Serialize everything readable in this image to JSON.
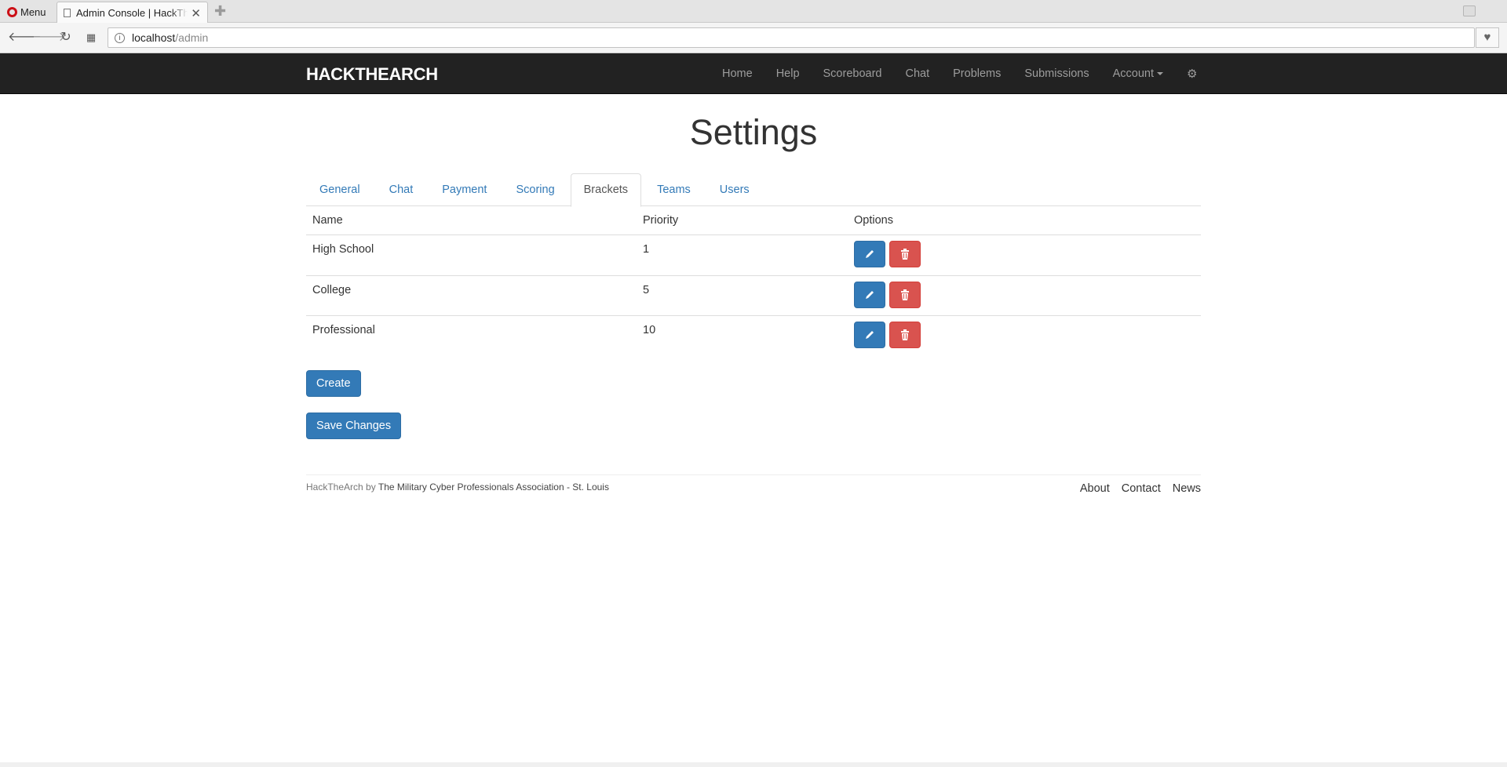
{
  "browser": {
    "menu_label": "Menu",
    "tab_title": "Admin Console | HackTheArch",
    "url_host": "localhost",
    "url_path": "/admin"
  },
  "navbar": {
    "brand": "HACKTHEARCH",
    "links": [
      "Home",
      "Help",
      "Scoreboard",
      "Chat",
      "Problems",
      "Submissions"
    ],
    "account": "Account"
  },
  "page": {
    "title": "Settings",
    "tabs": [
      "General",
      "Chat",
      "Payment",
      "Scoring",
      "Brackets",
      "Teams",
      "Users"
    ],
    "active_tab": "Brackets"
  },
  "table": {
    "headers": [
      "Name",
      "Priority",
      "Options"
    ],
    "rows": [
      {
        "name": "High School",
        "priority": "1"
      },
      {
        "name": "College",
        "priority": "5"
      },
      {
        "name": "Professional",
        "priority": "10"
      }
    ]
  },
  "buttons": {
    "create": "Create",
    "save": "Save Changes"
  },
  "footer": {
    "app": "HackTheArch",
    "by": "by",
    "org": "The Military Cyber Professionals Association - St. Louis",
    "links": [
      "About",
      "Contact",
      "News"
    ]
  },
  "colors": {
    "primary": "#337ab7",
    "danger": "#d9534f",
    "navbar": "#222222"
  }
}
